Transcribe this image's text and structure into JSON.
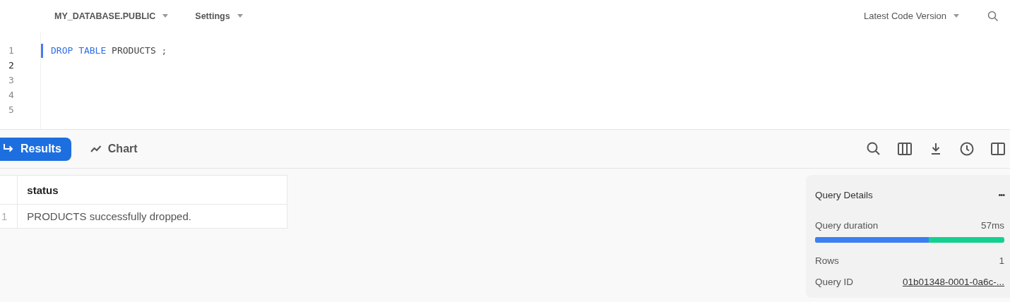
{
  "toolbar": {
    "context": "MY_DATABASE.PUBLIC",
    "settings": "Settings",
    "version": "Latest Code Version"
  },
  "editor": {
    "lines": [
      {
        "number": "1",
        "active": false,
        "tokens": [
          {
            "kind": "keyword",
            "text": "DROP"
          },
          {
            "kind": "keyword",
            "text": "TABLE"
          },
          {
            "kind": "identifier",
            "text": "PRODUCTS"
          },
          {
            "kind": "punct",
            "text": ";"
          }
        ]
      },
      {
        "number": "2",
        "active": true
      },
      {
        "number": "3",
        "active": false
      },
      {
        "number": "4",
        "active": false
      },
      {
        "number": "5",
        "active": false
      }
    ]
  },
  "result_tabs": [
    {
      "label": "Results",
      "kind": "results",
      "selected": true
    },
    {
      "label": "Chart",
      "kind": "chart",
      "selected": false
    }
  ],
  "table": {
    "columns": [
      "status"
    ],
    "rows": [
      {
        "number": "1",
        "cells": [
          "PRODUCTS successfully dropped."
        ]
      }
    ]
  },
  "query_details": {
    "title": "Query Details",
    "menu": "•••",
    "duration": {
      "label": "Query duration",
      "value": "57ms",
      "level": 0.6
    },
    "rows": {
      "label": "Rows",
      "value": "1"
    },
    "query_id": {
      "label": "Query ID",
      "value": "01b01348-0001-0a6c-..."
    }
  }
}
